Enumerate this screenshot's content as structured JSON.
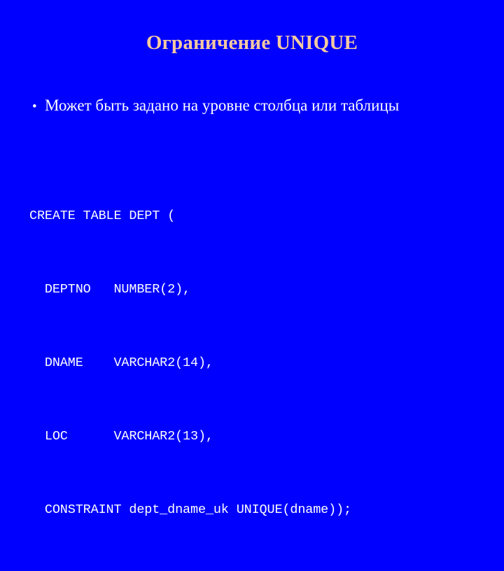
{
  "slide": {
    "background_color": "#0000FF",
    "title": "Ограничение UNIQUE",
    "title_color": "#F5C9A0",
    "body_text_color": "#FFFFFF"
  },
  "bullets": [
    {
      "marker": "•",
      "text": "Может быть задано на уровне столбца или таблицы"
    }
  ],
  "code": {
    "language": "sql",
    "lines": [
      "CREATE TABLE DEPT (",
      "  DEPTNO   NUMBER(2),",
      "  DNAME    VARCHAR2(14),",
      "  LOC      VARCHAR2(13),",
      "  CONSTRAINT dept_dname_uk UNIQUE(dname));"
    ]
  }
}
